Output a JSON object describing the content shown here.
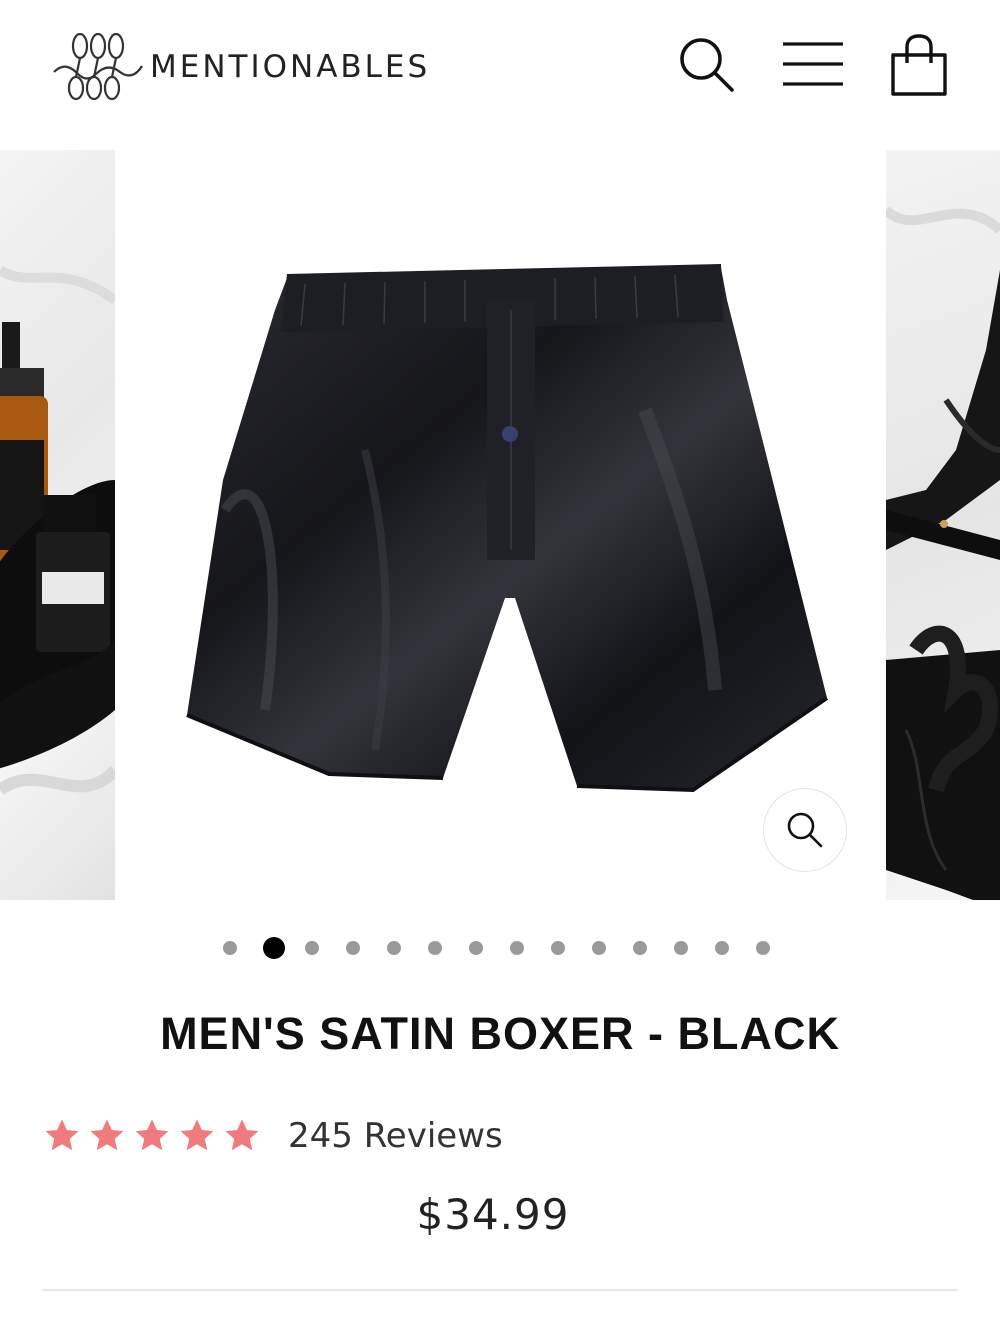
{
  "header": {
    "brand": "MENTIONABLES",
    "icons": [
      "search-icon",
      "menu-icon",
      "shopping-bag-icon"
    ]
  },
  "gallery": {
    "slide_count": 14,
    "active_index": 1,
    "zoom_icon": "magnifier-icon"
  },
  "product": {
    "title": "MEN'S SATIN BOXER - BLACK",
    "rating": 5,
    "reviews_label": "245 Reviews",
    "price": "$34.99"
  },
  "colors": {
    "star": "#ef7b7e",
    "active_dot": "#000000",
    "inactive_dot": "#9a9a9a"
  }
}
